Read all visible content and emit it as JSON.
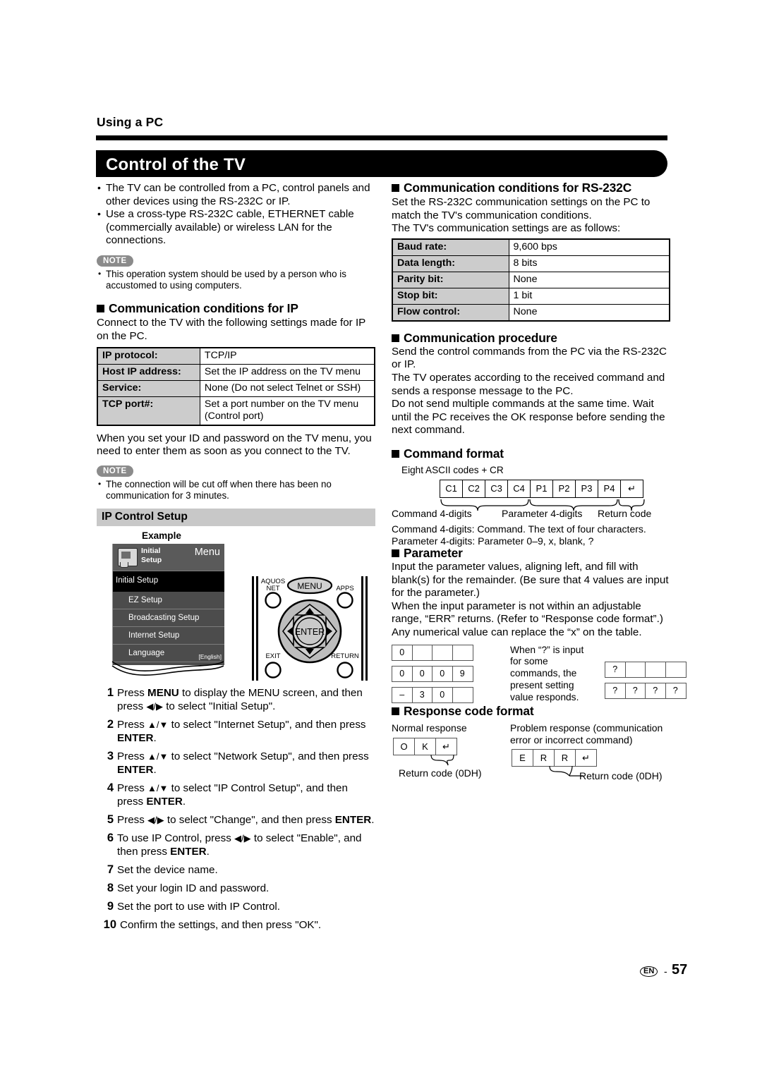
{
  "header": {
    "running_head": "Using a PC",
    "title": "Control of the TV"
  },
  "intro": {
    "bullets": [
      "The TV can be controlled from a PC, control panels and other devices using the RS-232C or IP.",
      "Use a cross-type RS-232C cable, ETHERNET cable (commercially available) or wireless LAN for the connections."
    ],
    "note_label": "NOTE",
    "notes": [
      "This operation system should be used by a person who is accustomed to using computers."
    ]
  },
  "ip_section": {
    "heading": "Communication conditions for IP",
    "intro": "Connect to the TV with the following settings made for IP on the PC.",
    "table": [
      {
        "key": "IP protocol:",
        "value": "TCP/IP"
      },
      {
        "key": "Host IP address:",
        "value": "Set the IP address on the TV menu"
      },
      {
        "key": "Service:",
        "value": "None (Do not select Telnet or SSH)"
      },
      {
        "key": "TCP port#:",
        "value": "Set a port number on the TV menu (Control port)"
      }
    ],
    "after_table": "When you set your ID and password on the TV menu, you need to enter them as soon as you connect to the TV.",
    "note_label": "NOTE",
    "notes": [
      "The connection will be cut off when there has been no communication for 3 minutes."
    ]
  },
  "ip_control_setup": {
    "heading": "IP Control Setup",
    "example_label": "Example",
    "tv_menu": {
      "icon_label_line1": "Initial",
      "icon_label_line2": "Setup",
      "menu_label": "Menu",
      "rows": [
        "Initial Setup",
        "EZ Setup",
        "Broadcasting Setup",
        "Internet Setup",
        "Language"
      ],
      "language_value": "[English]"
    },
    "remote": {
      "aquos_net_line1": "AQUOS",
      "aquos_net_line2": "NET",
      "menu": "MENU",
      "apps": "APPS",
      "enter": "ENTER",
      "exit": "EXIT",
      "return": "RETURN"
    },
    "steps": [
      {
        "n": "1",
        "html": "Press <b class=\"kb\">MENU</b> to display the MENU screen, and then press <span class=\"arr\">&#9664;/&#9654;</span> to select \"Initial Setup\"."
      },
      {
        "n": "2",
        "html": "Press <span class=\"arr\">&#9650;/&#9660;</span> to select \"Internet Setup\", and then press <b class=\"kb\">ENTER</b>."
      },
      {
        "n": "3",
        "html": "Press <span class=\"arr\">&#9650;/&#9660;</span> to select \"Network Setup\", and then press <b class=\"kb\">ENTER</b>."
      },
      {
        "n": "4",
        "html": "Press <span class=\"arr\">&#9650;/&#9660;</span> to select \"IP Control Setup\", and then press <b class=\"kb\">ENTER</b>."
      },
      {
        "n": "5",
        "html": "Press <span class=\"arr\">&#9664;/&#9654;</span> to select \"Change\", and then press <b class=\"kb\">ENTER</b>."
      },
      {
        "n": "6",
        "html": "To use IP Control, press <span class=\"arr\">&#9664;/&#9654;</span> to select \"Enable\", and then press <b class=\"kb\">ENTER</b>."
      },
      {
        "n": "7",
        "html": "Set the device name."
      },
      {
        "n": "8",
        "html": "Set your login ID and password."
      },
      {
        "n": "9",
        "html": "Set the port to use with IP Control."
      },
      {
        "n": "10",
        "html": "Confirm the settings, and then press \"OK\"."
      }
    ]
  },
  "rs232c_section": {
    "heading": "Communication conditions for RS-232C",
    "intro_line1": "Set the RS-232C communication settings on the PC to match the TV's communication conditions.",
    "intro_line2": "The TV's communication settings are as follows:",
    "table": [
      {
        "key": "Baud rate:",
        "value": "9,600 bps"
      },
      {
        "key": "Data length:",
        "value": "8 bits"
      },
      {
        "key": "Parity bit:",
        "value": "None"
      },
      {
        "key": "Stop bit:",
        "value": "1 bit"
      },
      {
        "key": "Flow control:",
        "value": "None"
      }
    ]
  },
  "procedure_section": {
    "heading": "Communication procedure",
    "paragraphs": [
      "Send the control commands from the PC via the RS-232C or IP.",
      "The TV operates according to the received command and sends a response message to the PC.",
      "Do not send multiple commands at the same time. Wait until the PC receives the OK response before sending the next command."
    ]
  },
  "command_format": {
    "heading": "Command format",
    "ascii_note": "Eight ASCII codes + CR",
    "boxes": [
      "C1",
      "C2",
      "C3",
      "C4",
      "P1",
      "P2",
      "P3",
      "P4",
      "↵"
    ],
    "brace_labels": {
      "command": "Command 4-digits",
      "parameter": "Parameter 4-digits",
      "return": "Return code"
    },
    "descriptions": [
      "Command 4-digits: Command. The text of four characters.",
      "Parameter 4-digits: Parameter 0–9, x, blank, ?"
    ]
  },
  "parameter_section": {
    "heading": "Parameter",
    "paragraphs": [
      "Input the parameter values, aligning left, and fill with blank(s) for the remainder. (Be sure that 4 values are input for the parameter.)",
      "When the input parameter is not within an adjustable range, “ERR” returns. (Refer to “Response code format”.)",
      "Any numerical value can replace the “x” on the table."
    ],
    "examples_left": [
      [
        "0",
        "",
        "",
        ""
      ],
      [
        "0",
        "0",
        "0",
        "9"
      ],
      [
        "–",
        "3",
        "0",
        ""
      ]
    ],
    "question_note": "When “?” is input for some commands, the present setting value responds.",
    "examples_right": [
      [
        "?",
        "",
        "",
        ""
      ],
      [
        "?",
        "?",
        "?",
        "?"
      ]
    ]
  },
  "response_section": {
    "heading": "Response code format",
    "normal_label": "Normal response",
    "normal_boxes": [
      "O",
      "K",
      "↵"
    ],
    "normal_return": "Return code (0DH)",
    "problem_label": "Problem response (communication error or incorrect command)",
    "problem_boxes": [
      "E",
      "R",
      "R",
      "↵"
    ],
    "problem_return": "Return code (0DH)"
  },
  "footer": {
    "lang_badge": "EN",
    "dash": "-",
    "page_number": "57"
  }
}
